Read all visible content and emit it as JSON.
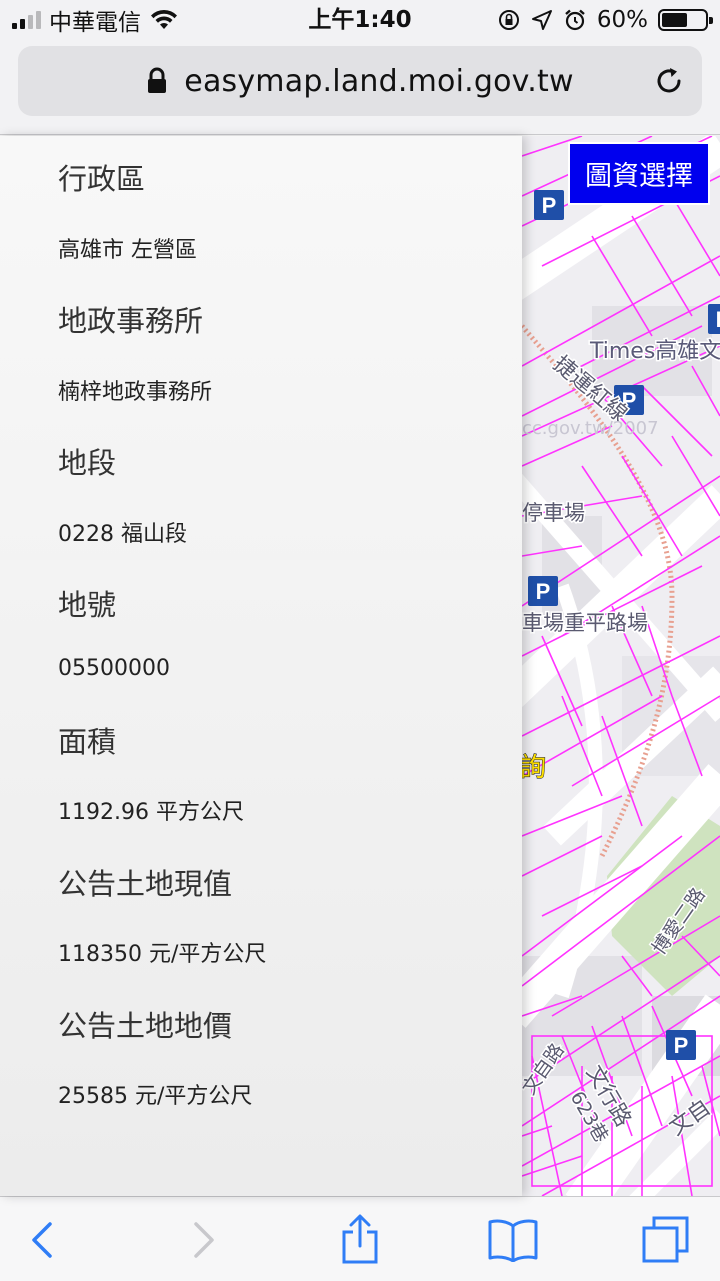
{
  "status_bar": {
    "carrier": "中華電信",
    "time": "上午1:40",
    "battery_percent": "60%",
    "battery_level": 0.6,
    "icons": [
      "signal-icon",
      "wifi-icon",
      "orientation-lock-icon",
      "location-arrow-icon",
      "alarm-icon",
      "battery-icon"
    ]
  },
  "browser": {
    "url": "easymap.land.moi.gov.tw",
    "icons": [
      "lock-icon",
      "reload-icon"
    ]
  },
  "panel": {
    "fields": [
      {
        "label": "行政區",
        "value": "高雄市 左營區"
      },
      {
        "label": "地政事務所",
        "value": "楠梓地政事務所"
      },
      {
        "label": "地段",
        "value": "0228 福山段"
      },
      {
        "label": "地號",
        "value": "05500000"
      },
      {
        "label": "面積",
        "value": "1192.96 平方公尺"
      },
      {
        "label": "公告土地現值",
        "value": "118350 元/平方公尺"
      },
      {
        "label": "公告土地地價",
        "value": "25585 元/平方公尺"
      }
    ]
  },
  "map": {
    "layer_button_label": "圖資選擇",
    "labels": {
      "times": "Times高雄文",
      "road_diag": "捷運紅線",
      "gov_url": "cc.gov.tw/2007",
      "parking_1": "停車場",
      "parking_2": "車場重平路場",
      "yellow": "詢",
      "road_a": "博愛二路",
      "road_b": "文自路",
      "road_c": "文行路",
      "lane": "623巷",
      "road_d": "文自"
    },
    "colors": {
      "parcel_line": "#ff33ff",
      "road": "#ffffff",
      "block": "#e4e3e8",
      "park": "#cfe3bf",
      "metro": "#e8a090",
      "parking_sign": "#1f4fa8"
    }
  },
  "toolbar": {
    "icons": [
      "back-icon",
      "forward-icon",
      "share-icon",
      "bookmarks-icon",
      "tabs-icon"
    ]
  }
}
